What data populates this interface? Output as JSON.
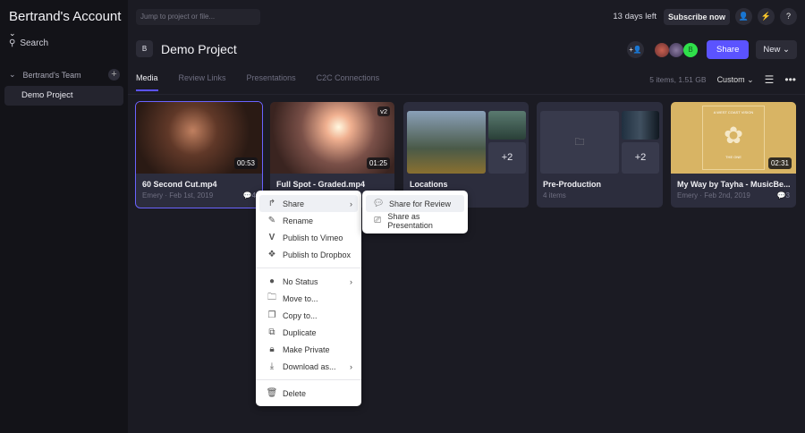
{
  "sidebar": {
    "account": "Bertrand's Account",
    "search": "Search",
    "team": "Bertrand's Team",
    "project": "Demo Project"
  },
  "topbar": {
    "jump_placeholder": "Jump to project or file...",
    "trial": "13 days left",
    "subscribe": "Subscribe now",
    "help": "?"
  },
  "project": {
    "badge": "B",
    "title": "Demo Project",
    "avatar_initial": "B",
    "share": "Share",
    "new": "New"
  },
  "tabs": [
    "Media",
    "Review Links",
    "Presentations",
    "C2C Connections"
  ],
  "toolbar": {
    "summary": "5 items, 1.51 GB",
    "sort": "Custom"
  },
  "cards": [
    {
      "title": "60 Second Cut.mp4",
      "meta": "Emery · Feb 1st, 2019",
      "comments": "4",
      "duration": "00:53"
    },
    {
      "title": "Full Spot - Graded.mp4",
      "duration": "01:25",
      "version": "v2"
    },
    {
      "title": "Locations",
      "extra": "+2"
    },
    {
      "title": "Pre-Production",
      "meta": "4 items",
      "extra": "+2"
    },
    {
      "title": "My Way by Tayha - MusicBe...",
      "meta": "Emery · Feb 2nd, 2019",
      "comments": "3",
      "duration": "02:31",
      "art_text_top": "A WEST COAST VISION",
      "art_text_bottom": "THE ONE"
    }
  ],
  "context_menu": [
    "Share",
    "Rename",
    "Publish to Vimeo",
    "Publish to Dropbox",
    "No Status",
    "Move to...",
    "Copy to...",
    "Duplicate",
    "Make Private",
    "Download as...",
    "Delete"
  ],
  "submenu": [
    "Share for Review",
    "Share as Presentation"
  ],
  "colors": {
    "accent": "#5b53ff",
    "avatar_green": "#2fe04a"
  }
}
